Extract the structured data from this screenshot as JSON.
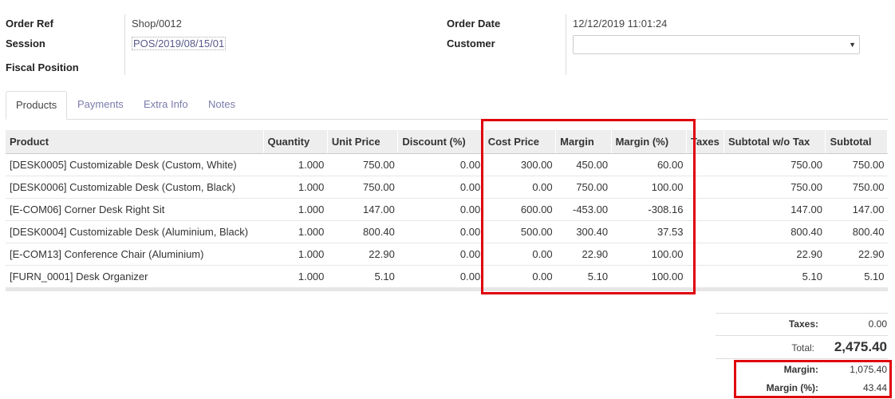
{
  "header": {
    "order_ref_label": "Order Ref",
    "order_ref_value": "Shop/0012",
    "session_label": "Session",
    "session_value": "POS/2019/08/15/01",
    "fiscal_position_label": "Fiscal Position",
    "order_date_label": "Order Date",
    "order_date_value": "12/12/2019 11:01:24",
    "customer_label": "Customer",
    "customer_value": ""
  },
  "tabs": [
    "Products",
    "Payments",
    "Extra Info",
    "Notes"
  ],
  "active_tab": "Products",
  "table": {
    "columns": [
      "Product",
      "Quantity",
      "Unit Price",
      "Discount (%)",
      "Cost Price",
      "Margin",
      "Margin (%)",
      "Taxes",
      "Subtotal w/o Tax",
      "Subtotal"
    ],
    "rows": [
      [
        "[DESK0005] Customizable Desk (Custom, White)",
        "1.000",
        "750.00",
        "0.00",
        "300.00",
        "450.00",
        "60.00",
        "",
        "750.00",
        "750.00"
      ],
      [
        "[DESK0006] Customizable Desk (Custom, Black)",
        "1.000",
        "750.00",
        "0.00",
        "0.00",
        "750.00",
        "100.00",
        "",
        "750.00",
        "750.00"
      ],
      [
        "[E-COM06] Corner Desk Right Sit",
        "1.000",
        "147.00",
        "0.00",
        "600.00",
        "-453.00",
        "-308.16",
        "",
        "147.00",
        "147.00"
      ],
      [
        "[DESK0004] Customizable Desk (Aluminium, Black)",
        "1.000",
        "800.40",
        "0.00",
        "500.00",
        "300.40",
        "37.53",
        "",
        "800.40",
        "800.40"
      ],
      [
        "[E-COM13] Conference Chair (Aluminium)",
        "1.000",
        "22.90",
        "0.00",
        "0.00",
        "22.90",
        "100.00",
        "",
        "22.90",
        "22.90"
      ],
      [
        "[FURN_0001] Desk Organizer",
        "1.000",
        "5.10",
        "0.00",
        "0.00",
        "5.10",
        "100.00",
        "",
        "5.10",
        "5.10"
      ]
    ]
  },
  "totals": {
    "taxes_label": "Taxes:",
    "taxes_value": "0.00",
    "total_label": "Total:",
    "total_value": "2,475.40",
    "margin_label": "Margin:",
    "margin_value": "1,075.40",
    "margin_pct_label": "Margin (%):",
    "margin_pct_value": "43.44"
  },
  "colors": {
    "highlight_box": "#e0000b",
    "tab_link": "#7c7bad",
    "header_bg": "#eeeeee"
  }
}
